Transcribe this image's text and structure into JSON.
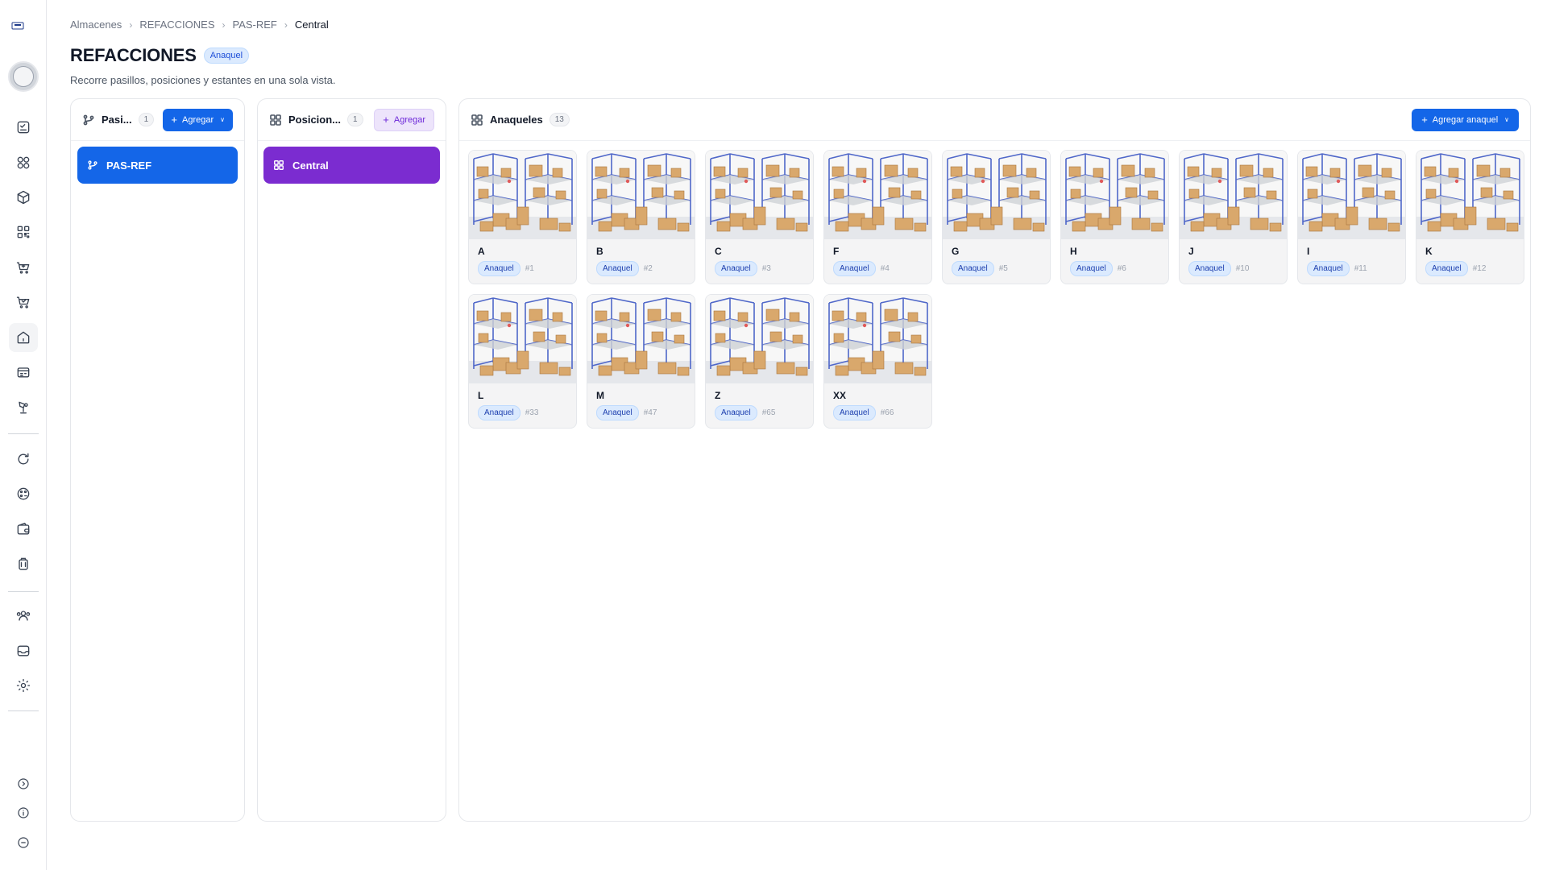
{
  "breadcrumb": [
    "Almacenes",
    "REFACCIONES",
    "PAS-REF",
    "Central"
  ],
  "page": {
    "title": "REFACCIONES",
    "badge": "Anaquel",
    "subtitle": "Recorre pasillos, posiciones y estantes en una sola vista."
  },
  "sidebar": {
    "icons": [
      "logo-icon",
      "checklist-icon",
      "grid-icon",
      "box-icon",
      "qr-icon",
      "cart-icon",
      "cart-check-icon",
      "warehouse-icon",
      "register-icon",
      "truck-icon",
      "refresh-icon",
      "palette-icon",
      "wallet-icon",
      "luggage-icon",
      "users-icon",
      "inbox-icon",
      "gear-icon",
      "expand-icon",
      "info-icon",
      "minus-icon"
    ],
    "active": "warehouse-icon"
  },
  "pasillos": {
    "title": "Pasi...",
    "count": "1",
    "add_label": "Agregar",
    "items": [
      {
        "label": "PAS-REF"
      }
    ]
  },
  "posiciones": {
    "title": "Posicion...",
    "count": "1",
    "add_label": "Agregar",
    "items": [
      {
        "label": "Central"
      }
    ]
  },
  "anaqueles": {
    "title": "Anaqueles",
    "count": "13",
    "add_label": "Agregar anaquel",
    "items": [
      {
        "name": "A",
        "type": "Anaquel",
        "number": "#1"
      },
      {
        "name": "B",
        "type": "Anaquel",
        "number": "#2"
      },
      {
        "name": "C",
        "type": "Anaquel",
        "number": "#3"
      },
      {
        "name": "F",
        "type": "Anaquel",
        "number": "#4"
      },
      {
        "name": "G",
        "type": "Anaquel",
        "number": "#5"
      },
      {
        "name": "H",
        "type": "Anaquel",
        "number": "#6"
      },
      {
        "name": "J",
        "type": "Anaquel",
        "number": "#10"
      },
      {
        "name": "I",
        "type": "Anaquel",
        "number": "#11"
      },
      {
        "name": "K",
        "type": "Anaquel",
        "number": "#12"
      },
      {
        "name": "L",
        "type": "Anaquel",
        "number": "#33"
      },
      {
        "name": "M",
        "type": "Anaquel",
        "number": "#47"
      },
      {
        "name": "Z",
        "type": "Anaquel",
        "number": "#65"
      },
      {
        "name": "XX",
        "type": "Anaquel",
        "number": "#66"
      }
    ]
  },
  "colors": {
    "primary": "#1466e8",
    "purple": "#7b2cd0",
    "badge_bg": "#dbeafe"
  }
}
